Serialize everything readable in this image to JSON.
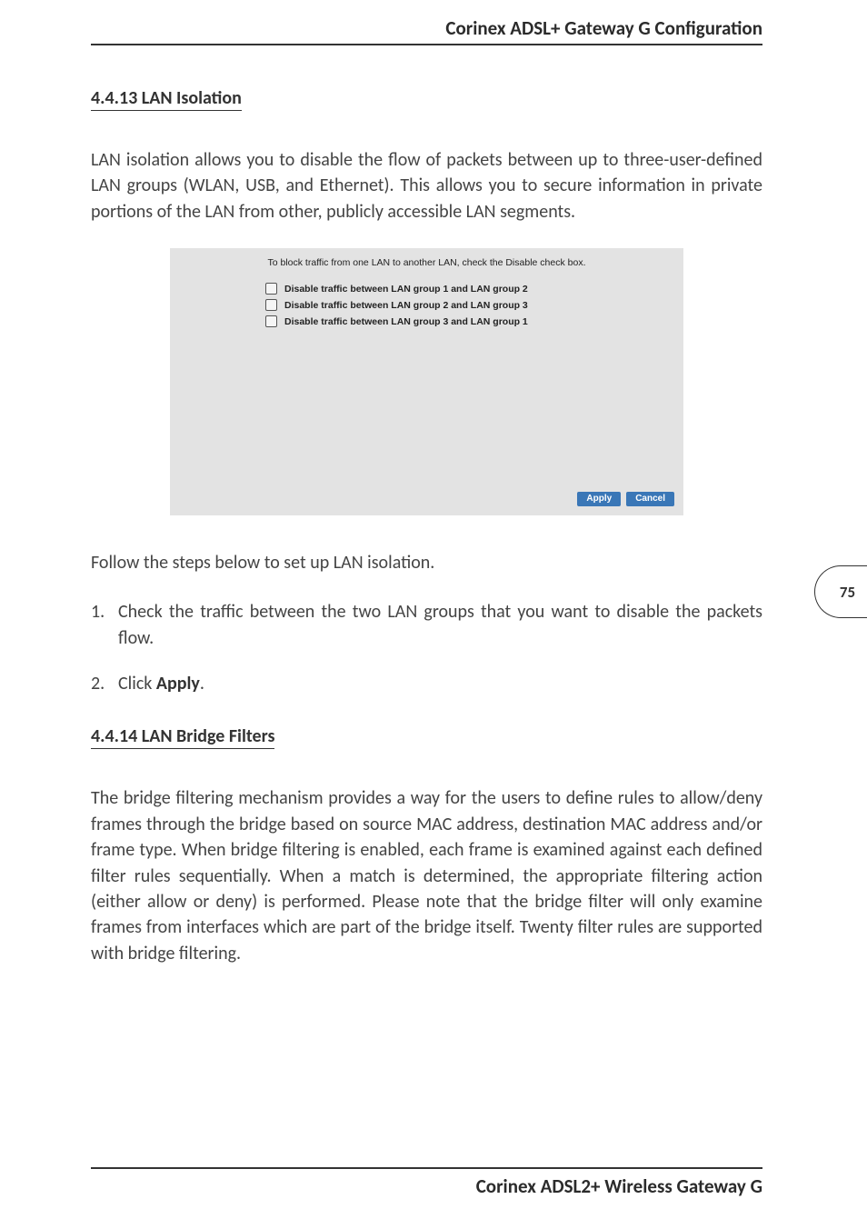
{
  "header": {
    "title": "Corinex ADSL+ Gateway G Configuration"
  },
  "page_number": "75",
  "section1": {
    "heading": "4.4.13  LAN Isolation",
    "intro": "LAN isolation allows you to disable the flow of packets between up to three-user-defined LAN groups (WLAN, USB, and Ethernet). This allows you to secure information in private portions of the LAN from other, publicly accessible LAN segments."
  },
  "ui": {
    "instruction": "To block traffic from one LAN to another LAN, check the Disable check box.",
    "checkboxes": [
      "Disable traffic between LAN group 1 and LAN group 2",
      "Disable traffic between LAN group 2 and LAN group 3",
      "Disable traffic between LAN group 3 and LAN group 1"
    ],
    "buttons": {
      "apply": "Apply",
      "cancel": "Cancel"
    }
  },
  "follow_text": "Follow the steps below to set up LAN isolation.",
  "steps": {
    "s1_num": "1.",
    "s1_txt": "Check the traffic between the two LAN groups that you want to disable the packets flow.",
    "s2_num": "2.",
    "s2_prefix": "Click ",
    "s2_bold": "Apply",
    "s2_suffix": "."
  },
  "section2": {
    "heading": "4.4.14  LAN Bridge Filters",
    "body": "The bridge filtering mechanism provides a way for the users to define rules to allow/deny frames through the bridge based on source MAC address, destination MAC address and/or frame type. When bridge filtering is enabled, each frame is examined against each defined filter rules sequentially. When a match is determined, the appropriate filtering action (either allow or deny) is performed. Please note that the bridge filter will only examine frames from interfaces which are part of the bridge itself. Twenty filter rules are supported with bridge filtering."
  },
  "footer": {
    "title": "Corinex ADSL2+ Wireless Gateway G"
  }
}
